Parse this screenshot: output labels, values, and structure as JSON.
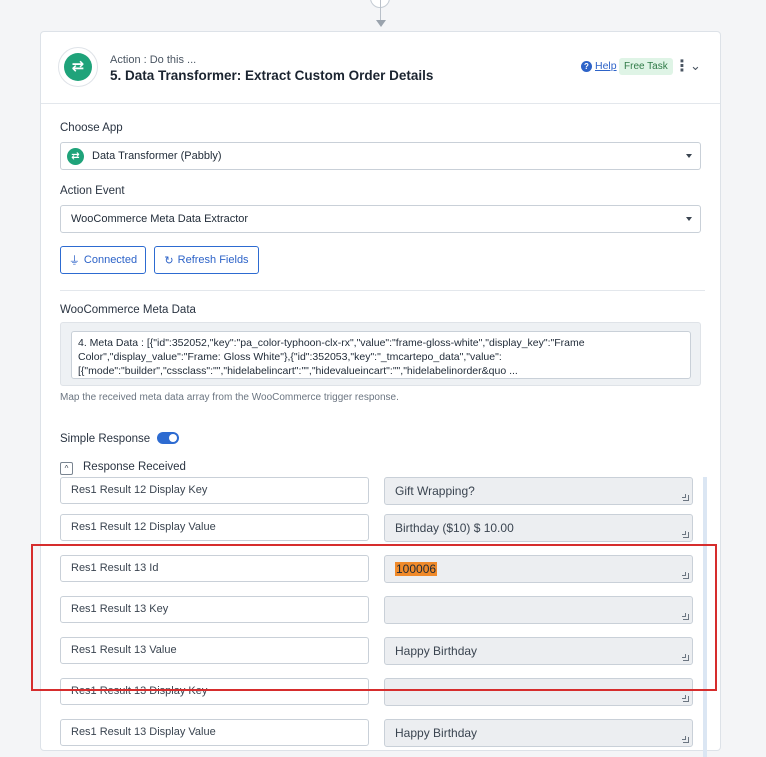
{
  "header": {
    "subtitle": "Action : Do this ...",
    "title": "5. Data Transformer: Extract Custom Order Details",
    "help_label": "Help",
    "help_icon": "?",
    "badge": "Free Task"
  },
  "choose_app": {
    "label": "Choose App",
    "value": "Data Transformer (Pabbly)"
  },
  "action_event": {
    "label": "Action Event",
    "value": "WooCommerce Meta Data Extractor"
  },
  "buttons": {
    "connected": "Connected",
    "refresh": "Refresh Fields"
  },
  "meta": {
    "label": "WooCommerce Meta Data",
    "value": "4. Meta Data : [{\"id\":352052,\"key\":\"pa_color-typhoon-clx-rx\",\"value\":\"frame-gloss-white\",\"display_key\":\"Frame Color\",\"display_value\":\"Frame: Gloss White\"},{\"id\":352053,\"key\":\"_tmcartepo_data\",\"value\":[{\"mode\":\"builder\",\"cssclass\":\"\",\"hidelabelincart\":\"\",\"hidevalueincart\":\"\",\"hidelabelinorder&quo ...",
    "helper": "Map the received meta data array from the WooCommerce trigger response."
  },
  "simple_response": {
    "label": "Simple Response",
    "enabled": true
  },
  "response_received": {
    "label": "Response Received",
    "toggle_glyph": "^"
  },
  "rows": [
    {
      "key": "Res1 Result 12 Display Key",
      "value": "Gift Wrapping?"
    },
    {
      "key": "Res1 Result 12 Display Value",
      "value": "Birthday ($10) $ 10.00"
    },
    {
      "key": "Res1 Result 13 Id",
      "value": "100006"
    },
    {
      "key": "Res1 Result 13 Key",
      "value": ""
    },
    {
      "key": "Res1 Result 13 Value",
      "value": "Happy Birthday"
    },
    {
      "key": "Res1 Result 13 Display Key",
      "value": ""
    },
    {
      "key": "Res1 Result 13 Display Value",
      "value": "Happy Birthday"
    }
  ],
  "colors": {
    "accent": "#2d6bd1",
    "brand_green": "#1fa37a",
    "highlight": "#f08a2a",
    "annotation_red": "#d62d2d"
  }
}
